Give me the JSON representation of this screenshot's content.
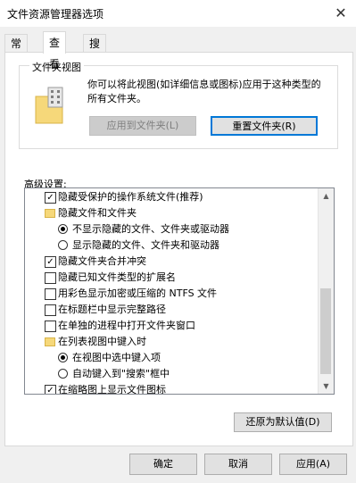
{
  "window": {
    "title": "文件资源管理器选项"
  },
  "tabs": [
    {
      "label": "常规"
    },
    {
      "label": "查看"
    },
    {
      "label": "搜索"
    }
  ],
  "folder_view": {
    "group_title": "文件夹视图",
    "description": "你可以将此视图(如详细信息或图标)应用于这种类型的所有文件夹。",
    "apply_button": "应用到文件夹(L)",
    "reset_button": "重置文件夹(R)"
  },
  "advanced": {
    "label": "高级设置:",
    "items": [
      {
        "type": "checkbox",
        "checked": true,
        "label": "隐藏受保护的操作系统文件(推荐)"
      },
      {
        "type": "folder",
        "label": "隐藏文件和文件夹"
      },
      {
        "type": "radio",
        "checked": true,
        "label": "不显示隐藏的文件、文件夹或驱动器"
      },
      {
        "type": "radio",
        "checked": false,
        "label": "显示隐藏的文件、文件夹和驱动器"
      },
      {
        "type": "checkbox",
        "checked": true,
        "label": "隐藏文件夹合并冲突"
      },
      {
        "type": "checkbox",
        "checked": false,
        "label": "隐藏已知文件类型的扩展名"
      },
      {
        "type": "checkbox",
        "checked": false,
        "label": "用彩色显示加密或压缩的 NTFS 文件"
      },
      {
        "type": "checkbox",
        "checked": false,
        "label": "在标题栏中显示完整路径"
      },
      {
        "type": "checkbox",
        "checked": false,
        "label": "在单独的进程中打开文件夹窗口"
      },
      {
        "type": "folder",
        "label": "在列表视图中键入时"
      },
      {
        "type": "radio",
        "checked": true,
        "label": "在视图中选中键入项"
      },
      {
        "type": "radio",
        "checked": false,
        "label": "自动键入到\"搜索\"框中"
      },
      {
        "type": "checkbox",
        "checked": true,
        "label": "在缩略图上显示文件图标"
      }
    ],
    "restore_button": "还原为默认值(D)"
  },
  "footer": {
    "ok": "确定",
    "cancel": "取消",
    "apply": "应用(A)"
  },
  "icons": {
    "close": "close-icon",
    "folder": "folder-icon",
    "scroll_up": "chevron-up-icon",
    "scroll_down": "chevron-down-icon"
  }
}
